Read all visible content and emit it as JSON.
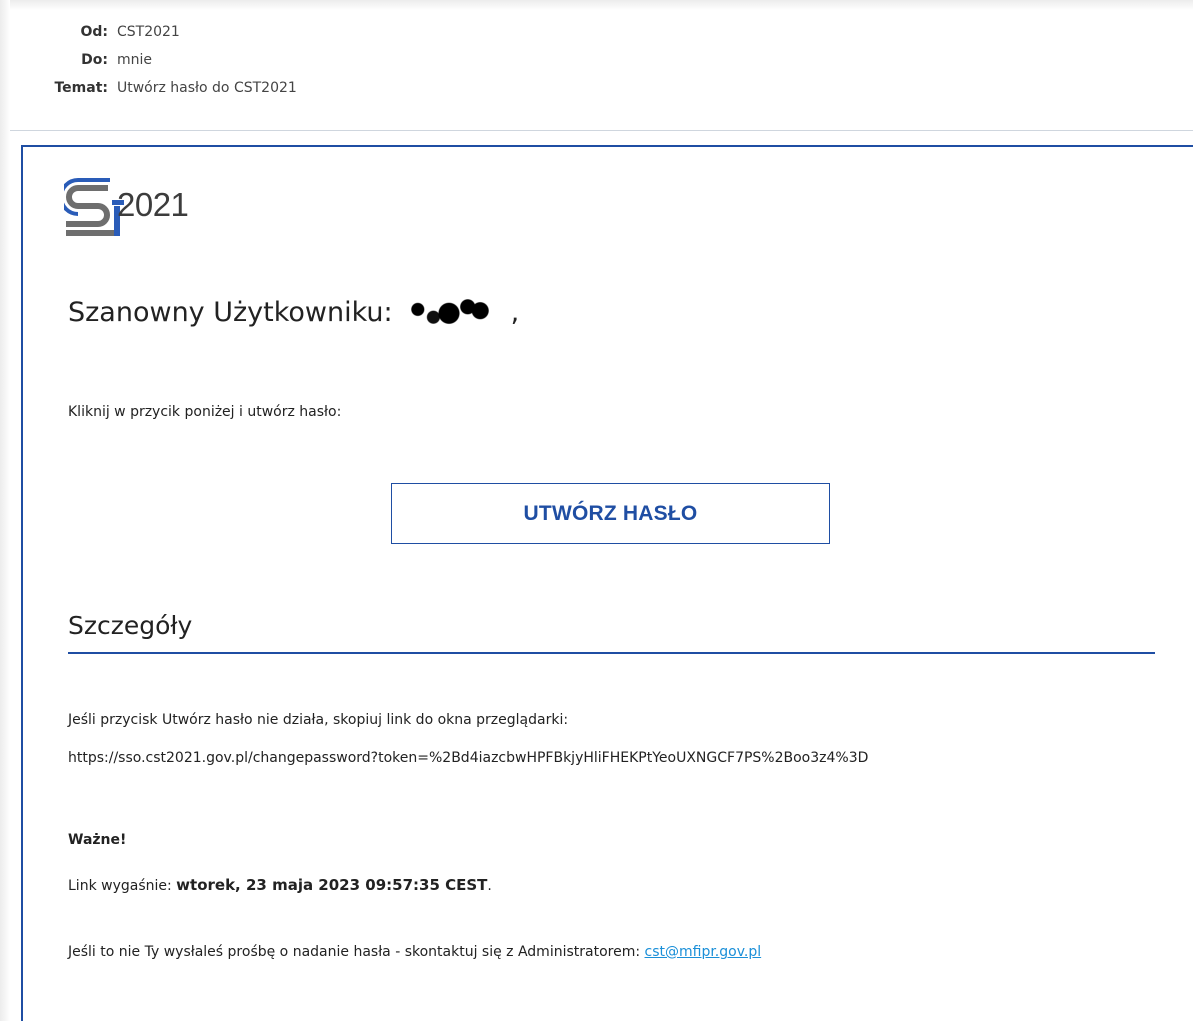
{
  "header": {
    "from_label": "Od:",
    "from_value": "CST2021",
    "to_label": "Do:",
    "to_value": "mnie",
    "subject_label": "Temat:",
    "subject_value": "Utwórz hasło do CST2021"
  },
  "body": {
    "logo_text": "2021",
    "greeting": "Szanowny Użytkowniku:",
    "greeting_suffix": ",",
    "instruction": "Kliknij w przycik poniżej i utwórz hasło:",
    "button_label": "UTWÓRZ HASŁO",
    "section_title": "Szczegóły",
    "fallback_text": "Jeśli przycisk Utwórz hasło nie działa, skopiuj link do okna przeglądarki:",
    "url": "https://sso.cst2021.gov.pl/changepassword?token=%2Bd4iazcbwHPFBkjyHliFHEKPtYeoUXNGCF7PS%2Boo3z4%3D",
    "important": "Ważne!",
    "expires_prefix": "Link wygaśnie: ",
    "expires_value": "wtorek, 23 maja 2023 09:57:35 CEST",
    "expires_suffix": ".",
    "contact_text": "Jeśli to nie Ty wysłaleś prośbę o nadanie hasła - skontaktuj się z Administratorem: ",
    "contact_email": "cst@mfipr.gov.pl"
  },
  "colors": {
    "accent": "#1f4ea3",
    "link": "#1a8fd8",
    "logo_gray": "#6e6e6e",
    "logo_blue": "#2a5cb8"
  },
  "icons": {
    "logo": "cst2021-logo",
    "redaction": "redacted-username-mark"
  }
}
